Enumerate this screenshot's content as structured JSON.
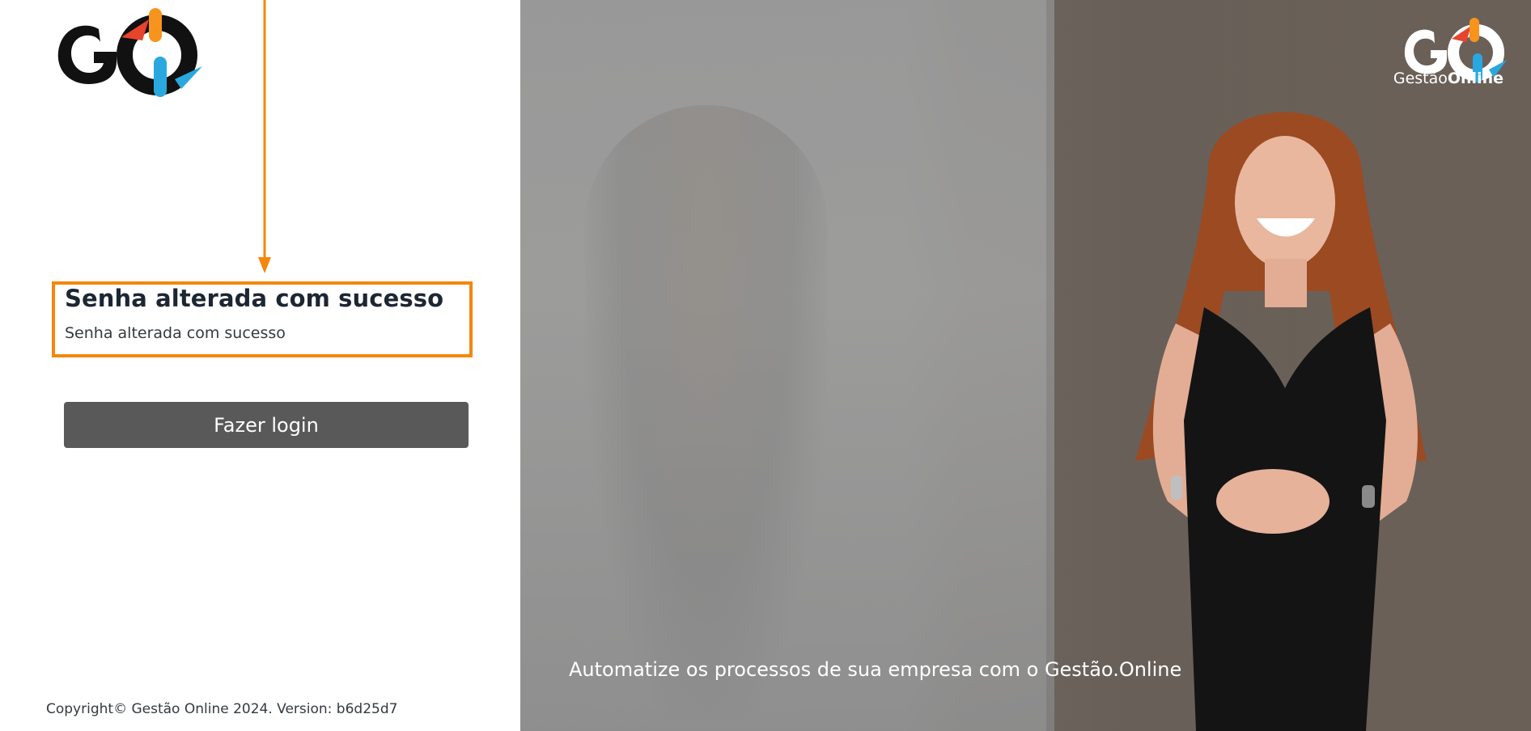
{
  "status": {
    "title": "Senha alterada com sucesso",
    "message": "Senha alterada com sucesso"
  },
  "actions": {
    "login_label": "Fazer login"
  },
  "footer": {
    "copyright": "Copyright© Gestão Online 2024. Version: b6d25d7"
  },
  "hero": {
    "tagline": "Automatize os processos de sua empresa com o Gestão.Online",
    "brand_light": "Gestão",
    "brand_bold": "Online"
  },
  "logo": {
    "text": "GO"
  },
  "colors": {
    "accent_orange": "#f5870c",
    "button_bg": "#595959",
    "logo_orange": "#f7941d",
    "logo_blue": "#29a8e0",
    "logo_red": "#e8432b"
  }
}
